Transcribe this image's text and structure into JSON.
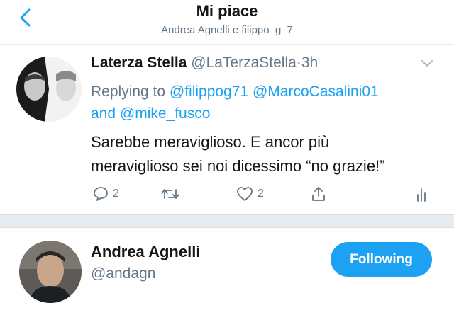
{
  "header": {
    "title": "Mi piace",
    "subtitle": "Andrea Agnelli e filippo_g_7",
    "back_icon": "chevron-left-icon"
  },
  "tweet": {
    "author_name": "Laterza Stella",
    "author_handle": "@LaTerzaStella",
    "separator": "·",
    "time": "3h",
    "reply_prefix": "Replying to ",
    "mentions": [
      "@filippog71",
      "@MarcoCasalini01",
      "@mike_fusco"
    ],
    "and_word": "and",
    "text_line1": "Sarebbe meraviglioso. E ancor più",
    "text_line2": "meraviglioso sei noi dicessimo “no grazie!”",
    "reply_count": "2",
    "like_count": "2",
    "icons": [
      "comment-icon",
      "retweet-icon",
      "heart-icon",
      "share-icon",
      "analytics-icon",
      "caret-down-icon"
    ]
  },
  "user": {
    "name": "Andrea Agnelli",
    "handle": "@andagn",
    "follow_label": "Following"
  },
  "colors": {
    "accent": "#1da1f2",
    "secondary_text": "#657786",
    "primary_text": "#14171a",
    "separator": "#e6ecf0"
  }
}
